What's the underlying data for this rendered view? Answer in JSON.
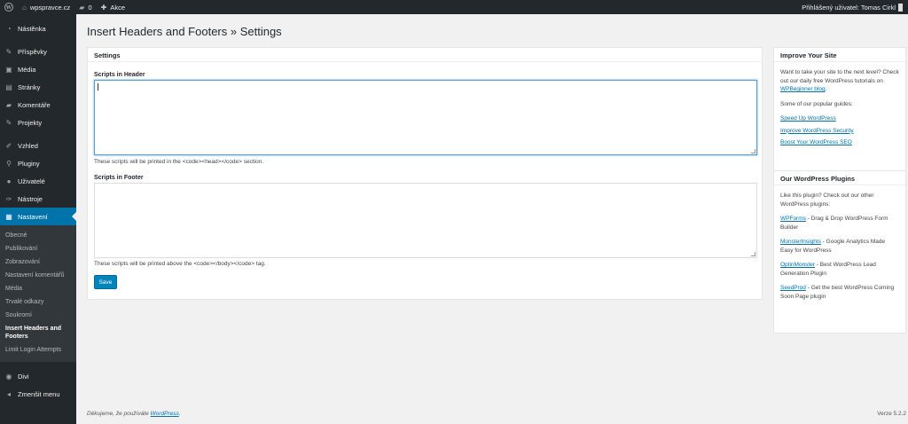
{
  "adminbar": {
    "site_name": "wpspravce.cz",
    "comments_count": "0",
    "new_label": "Akce",
    "user_greeting": "Přihlášený uživatel: Tomas Cirkl"
  },
  "sidebar": {
    "items_top": [
      {
        "label": "Nástěnka",
        "icon": "gauge-icon",
        "glyph": "◔"
      }
    ],
    "items_content": [
      {
        "label": "Příspěvky",
        "icon": "pin-icon",
        "glyph": "✎"
      },
      {
        "label": "Média",
        "icon": "media-icon",
        "glyph": "▣"
      },
      {
        "label": "Stránky",
        "icon": "page-icon",
        "glyph": "▤"
      },
      {
        "label": "Komentáře",
        "icon": "comment-icon",
        "glyph": "▰"
      },
      {
        "label": "Projekty",
        "icon": "pin-icon",
        "glyph": "✎"
      }
    ],
    "items_admin": [
      {
        "label": "Vzhled",
        "icon": "brush-icon",
        "glyph": "✐"
      },
      {
        "label": "Pluginy",
        "icon": "plugin-icon",
        "glyph": "⚲"
      },
      {
        "label": "Uživatelé",
        "icon": "user-icon",
        "glyph": "●"
      },
      {
        "label": "Nástroje",
        "icon": "wrench-icon",
        "glyph": "✑"
      }
    ],
    "current": {
      "label": "Nastavení",
      "icon": "settings-icon",
      "glyph": "▦"
    },
    "submenu": [
      "Obecné",
      "Publikování",
      "Zobrazování",
      "Nastavení komentářů",
      "Média",
      "Trvalé odkazy",
      "Soukromí",
      "Insert Headers and Footers",
      "Limit Login Attempts"
    ],
    "submenu_active_index": 7,
    "items_bottom": [
      {
        "label": "Divi",
        "icon": "divi-icon",
        "glyph": "◉"
      },
      {
        "label": "Zmenšit menu",
        "icon": "collapse-icon",
        "glyph": "◂"
      }
    ]
  },
  "main": {
    "page_title": "Insert Headers and Footers » Settings",
    "settings_box": {
      "title": "Settings",
      "header_label": "Scripts in Header",
      "header_value": "",
      "header_desc": "These scripts will be printed in the <code><head></code> section.",
      "footer_label": "Scripts in Footer",
      "footer_value": "",
      "footer_desc": "These scripts will be printed above the <code></body></code> tag.",
      "save_label": "Save"
    },
    "improve_box": {
      "title": "Improve Your Site",
      "intro_before": "Want to take your site to the next level? Check out our daily free WordPress tutorials on ",
      "intro_link": "WPBeginner blog",
      "intro_after": ".",
      "guides_label": "Some of our popular guides:",
      "guides": [
        "Speed Up WordPress",
        "Improve WordPress Security",
        "Boost Your WordPress SEO"
      ]
    },
    "plugins_box": {
      "title": "Our WordPress Plugins",
      "intro": "Like this plugin? Check out our other WordPress plugins:",
      "plugins": [
        {
          "name": "WPForms",
          "desc": " - Drag & Drop WordPress Form Builder"
        },
        {
          "name": "MonsterInsights",
          "desc": " - Google Analytics Made Easy for WordPress"
        },
        {
          "name": "OptinMonster",
          "desc": " - Best WordPress Lead Generation Plugin"
        },
        {
          "name": "SeedProd",
          "desc": " - Get the best WordPress Coming Soon Page plugin"
        }
      ]
    }
  },
  "footer": {
    "thanks_before": "Děkujeme, že používáte ",
    "thanks_link": "WordPress",
    "thanks_after": ".",
    "version": "Verze 5.2.2"
  },
  "colors": {
    "admin_dark": "#23282d",
    "accent": "#0073aa",
    "button": "#0085ba",
    "background": "#f1f1f1"
  }
}
